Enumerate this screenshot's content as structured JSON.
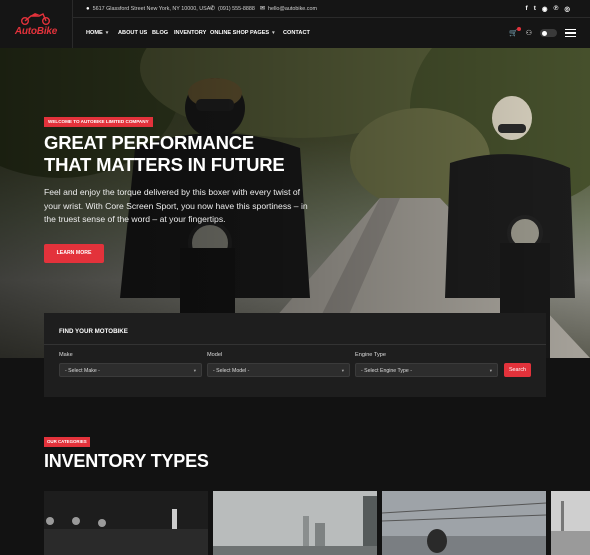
{
  "brand": {
    "name": "AutoBike",
    "accent": "#e3323b"
  },
  "topbar": {
    "address": "5617 Glassford Street New York, NY 10000, USA",
    "phone": "(091) 555-8888",
    "email": "hello@autobike.com",
    "social_icons": [
      "facebook-icon",
      "twitter-icon",
      "github-icon",
      "pinterest-icon",
      "instagram-icon"
    ]
  },
  "nav": {
    "items": [
      {
        "label": "Home",
        "has_dropdown": true
      },
      {
        "label": "About Us",
        "has_dropdown": false
      },
      {
        "label": "Blog",
        "has_dropdown": false
      },
      {
        "label": "Inventory",
        "has_dropdown": false
      },
      {
        "label": "Online Shop",
        "has_dropdown": false
      },
      {
        "label": "Pages",
        "has_dropdown": true
      },
      {
        "label": "Contact",
        "has_dropdown": false
      }
    ]
  },
  "hero": {
    "badge": "Welcome to AutoBike Limited Company",
    "title": "Great Performance That Matters in Future",
    "text": "Feel and enjoy the torque delivered by this boxer with every twist of your wrist. With Core Screen Sport, you now have this sportiness – in the truest sense of the word – at your fingertips.",
    "button": "Learn More"
  },
  "search": {
    "title": "Find Your Motobike",
    "fields": [
      {
        "label": "Make",
        "value": "- Select Make -"
      },
      {
        "label": "Model",
        "value": "- Select Model -"
      },
      {
        "label": "Engine Type",
        "value": "- Select Engine Type -"
      }
    ],
    "button": "Search"
  },
  "categories": {
    "badge": "Our Categories",
    "title": "Inventory Types"
  }
}
